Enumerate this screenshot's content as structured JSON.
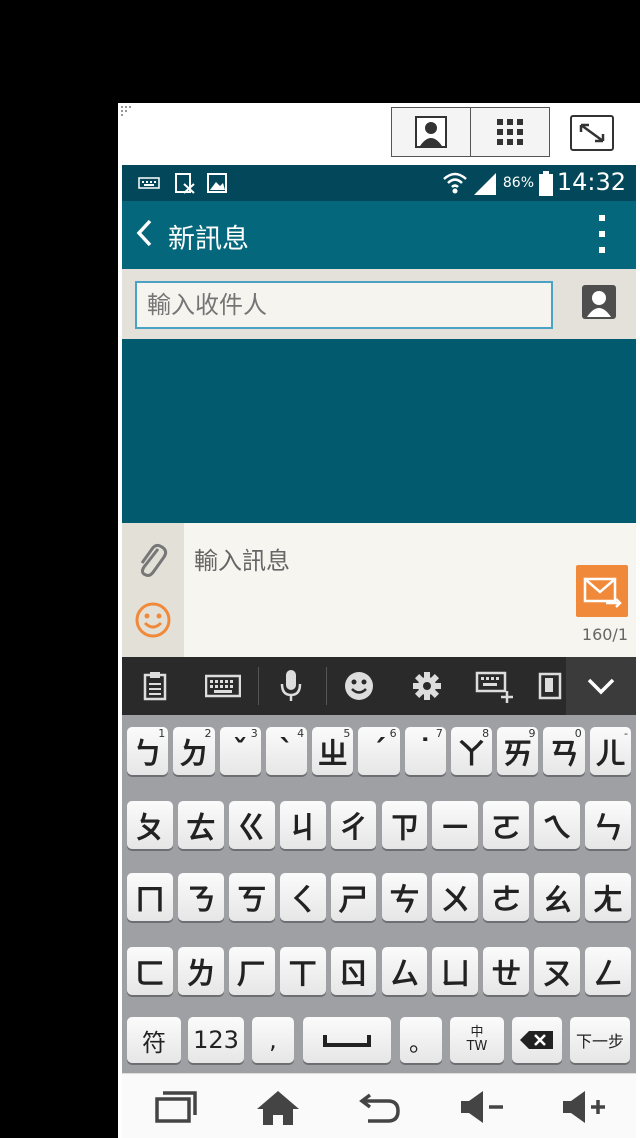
{
  "status_bar": {
    "battery_percent": "86%",
    "time": "14:32"
  },
  "action_bar": {
    "back_icon": "chevron-left-icon",
    "title": "新訊息",
    "more_icon": "more-vertical-icon"
  },
  "recipient": {
    "placeholder": "輸入收件人"
  },
  "compose": {
    "placeholder": "輸入訊息",
    "counter": "160/1",
    "accent": "#f08a3a"
  },
  "colors": {
    "status_bar": "#03485a",
    "action_bar": "#04677b",
    "conversation_bg": "#015a6d",
    "keyboard_bg": "#9fa0a4"
  },
  "keyboard": {
    "rows": [
      [
        {
          "k": "ㄅ",
          "h": "1"
        },
        {
          "k": "ㄉ",
          "h": "2"
        },
        {
          "k": "ˇ",
          "h": "3"
        },
        {
          "k": "ˋ",
          "h": "4"
        },
        {
          "k": "ㄓ",
          "h": "5"
        },
        {
          "k": "ˊ",
          "h": "6"
        },
        {
          "k": "˙",
          "h": "7"
        },
        {
          "k": "ㄚ",
          "h": "8"
        },
        {
          "k": "ㄞ",
          "h": "9"
        },
        {
          "k": "ㄢ",
          "h": "0"
        },
        {
          "k": "ㄦ",
          "h": "-"
        }
      ],
      [
        {
          "k": "ㄆ",
          "h": ""
        },
        {
          "k": "ㄊ",
          "h": ""
        },
        {
          "k": "ㄍ",
          "h": ""
        },
        {
          "k": "ㄐ",
          "h": ""
        },
        {
          "k": "ㄔ",
          "h": ""
        },
        {
          "k": "ㄗ",
          "h": ""
        },
        {
          "k": "ㄧ",
          "h": ""
        },
        {
          "k": "ㄛ",
          "h": ""
        },
        {
          "k": "ㄟ",
          "h": ""
        },
        {
          "k": "ㄣ",
          "h": ""
        }
      ],
      [
        {
          "k": "ㄇ",
          "h": ""
        },
        {
          "k": "ㄋ",
          "h": ""
        },
        {
          "k": "ㄎ",
          "h": ""
        },
        {
          "k": "ㄑ",
          "h": ""
        },
        {
          "k": "ㄕ",
          "h": ""
        },
        {
          "k": "ㄘ",
          "h": ""
        },
        {
          "k": "ㄨ",
          "h": ""
        },
        {
          "k": "ㄜ",
          "h": ""
        },
        {
          "k": "ㄠ",
          "h": ""
        },
        {
          "k": "ㄤ",
          "h": ""
        }
      ],
      [
        {
          "k": "ㄈ",
          "h": ""
        },
        {
          "k": "ㄌ",
          "h": ""
        },
        {
          "k": "ㄏ",
          "h": ""
        },
        {
          "k": "ㄒ",
          "h": ""
        },
        {
          "k": "ㄖ",
          "h": ""
        },
        {
          "k": "ㄙ",
          "h": ""
        },
        {
          "k": "ㄩ",
          "h": ""
        },
        {
          "k": "ㄝ",
          "h": ""
        },
        {
          "k": "ㄡ",
          "h": ""
        },
        {
          "k": "ㄥ",
          "h": ""
        }
      ]
    ],
    "bottom_row": {
      "symbols": "符",
      "numbers": "123",
      "comma": ",",
      "period": "。",
      "lang_top": "中",
      "lang_bottom": "TW",
      "next": "下一步"
    }
  }
}
